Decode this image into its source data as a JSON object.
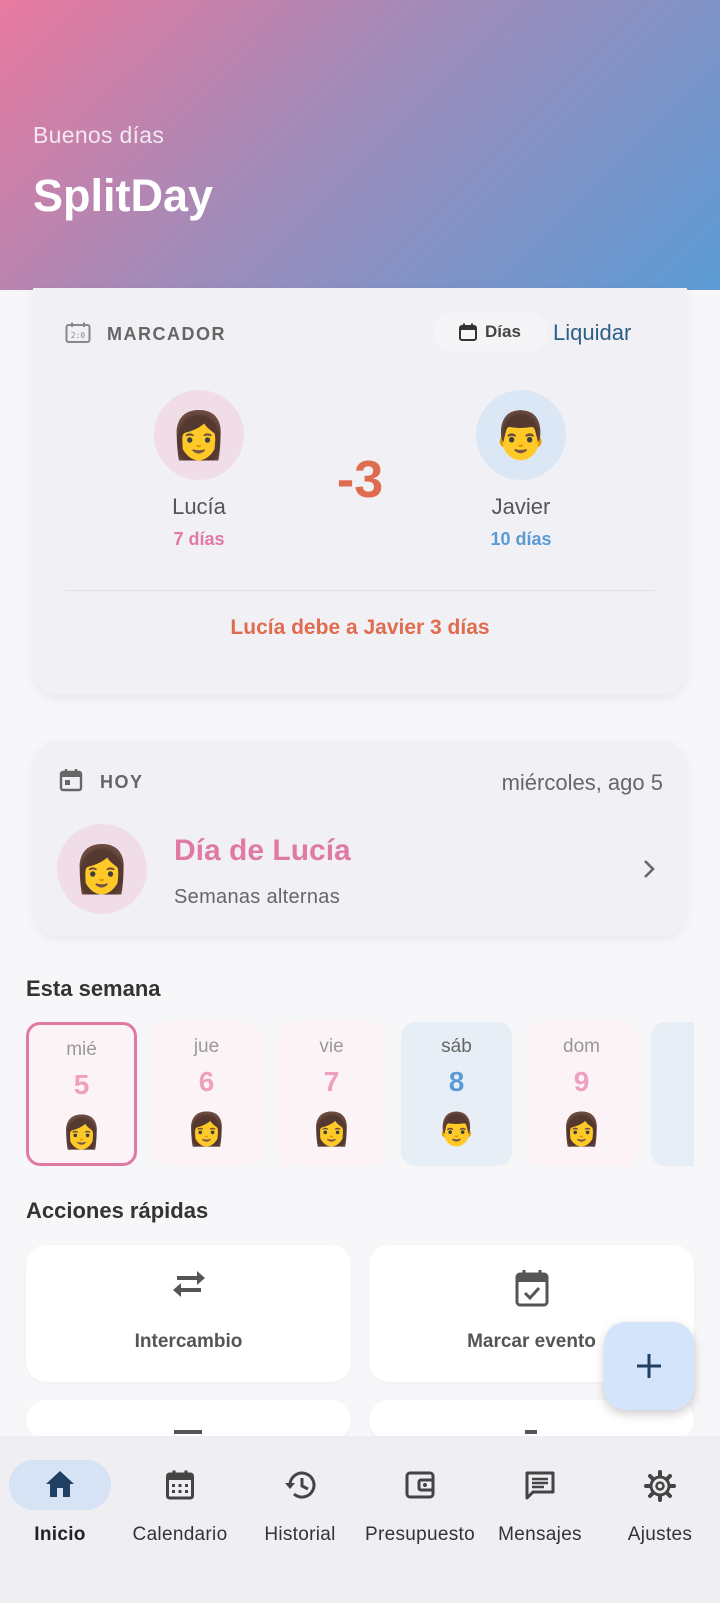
{
  "header": {
    "greeting": "Buenos días",
    "title": "SplitDay"
  },
  "scoreboard": {
    "label": "MARCADOR",
    "unit_chip": "Días",
    "settle_label": "Liquidar",
    "left": {
      "name": "Lucía",
      "days": "7 días",
      "avatar": "👩",
      "color": "#e07aa5"
    },
    "right": {
      "name": "Javier",
      "days": "10 días",
      "avatar": "👨",
      "color": "#5b9bd5"
    },
    "difference": "-3",
    "summary": "Lucía debe a Javier 3 días"
  },
  "today": {
    "label": "HOY",
    "date": "miércoles, ago 5",
    "title": "Día de Lucía",
    "subtitle": "Semanas alternas",
    "avatar": "👩"
  },
  "week": {
    "title": "Esta semana",
    "days": [
      {
        "name": "mié",
        "num": "5",
        "emoji": "👩",
        "owner": "pink",
        "selected": true
      },
      {
        "name": "jue",
        "num": "6",
        "emoji": "👩",
        "owner": "pink",
        "selected": false
      },
      {
        "name": "vie",
        "num": "7",
        "emoji": "👩",
        "owner": "pink",
        "selected": false
      },
      {
        "name": "sáb",
        "num": "8",
        "emoji": "👨",
        "owner": "blue",
        "selected": false
      },
      {
        "name": "dom",
        "num": "9",
        "emoji": "👩",
        "owner": "pink",
        "selected": false
      }
    ]
  },
  "quick_actions": {
    "title": "Acciones rápidas",
    "items": [
      {
        "label": "Intercambio",
        "icon": "swap-icon"
      },
      {
        "label": "Marcar evento",
        "icon": "event-check-icon"
      }
    ]
  },
  "fab": {
    "icon": "plus-icon"
  },
  "nav": {
    "items": [
      {
        "label": "Inicio",
        "icon": "home-icon",
        "active": true
      },
      {
        "label": "Calendario",
        "icon": "calendar-icon",
        "active": false
      },
      {
        "label": "Historial",
        "icon": "history-icon",
        "active": false
      },
      {
        "label": "Presupuesto",
        "icon": "wallet-icon",
        "active": false
      },
      {
        "label": "Mensajes",
        "icon": "message-icon",
        "active": false
      },
      {
        "label": "Ajustes",
        "icon": "gear-icon",
        "active": false
      }
    ]
  },
  "colors": {
    "pink": "#e07aa5",
    "blue": "#5b9bd5",
    "accent_orange": "#e06c4f",
    "link": "#2c5f86"
  }
}
